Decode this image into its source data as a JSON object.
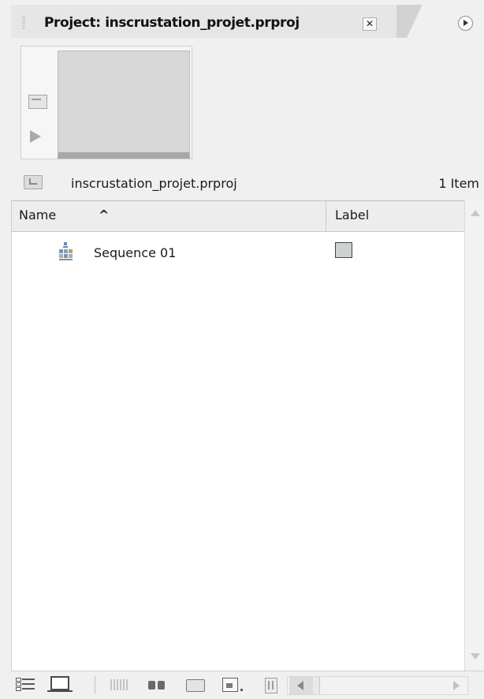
{
  "panel": {
    "tab_title": "Project: inscrustation_projet.prproj",
    "close_glyph": "✕",
    "menu_icon": "panel-menu-icon"
  },
  "project": {
    "name": "inscrustation_projet.prproj",
    "item_count": "1 Item"
  },
  "columns": {
    "name": "Name",
    "sort_glyph": "^",
    "label": "Label"
  },
  "items": [
    {
      "name": "Sequence 01",
      "icon": "sequence-icon",
      "label_color": "#cdd1d1"
    }
  ],
  "toolbar": {
    "icons": [
      "list-view-icon",
      "icon-view-icon",
      "automate-to-sequence-icon",
      "find-icon",
      "new-bin-icon",
      "new-item-icon",
      "clear-icon"
    ]
  },
  "colors": {
    "panel_bg": "#f0f0f0",
    "list_bg": "#ffffff",
    "header_bg": "#ededed"
  }
}
